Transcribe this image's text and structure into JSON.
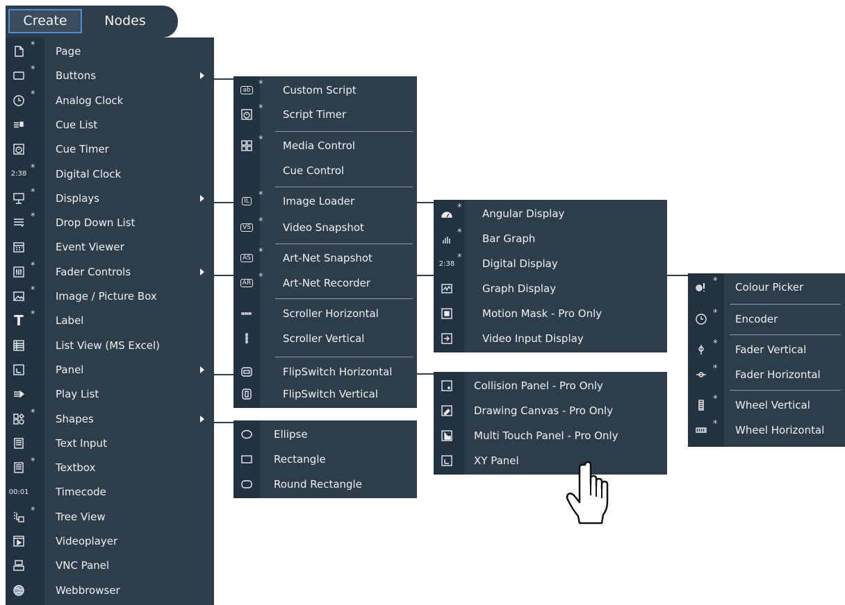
{
  "menubar": {
    "create": "Create",
    "nodes": "Nodes"
  },
  "create_menu": [
    {
      "icon": "page-icon",
      "label": "Page",
      "star": true
    },
    {
      "icon": "button-icon",
      "label": "Buttons",
      "star": true,
      "submenu": true
    },
    {
      "icon": "analog-clock-icon",
      "label": "Analog Clock",
      "star": true
    },
    {
      "icon": "cue-list-icon",
      "label": "Cue List",
      "star": false
    },
    {
      "icon": "cue-timer-icon",
      "label": "Cue Timer",
      "star": false
    },
    {
      "icon": "digital-clock-icon",
      "label": "Digital Clock",
      "star": true,
      "glyph": "2:38"
    },
    {
      "icon": "display-icon",
      "label": "Displays",
      "star": true,
      "submenu": true
    },
    {
      "icon": "drop-down-icon",
      "label": "Drop Down List",
      "star": true
    },
    {
      "icon": "calendar-icon",
      "label": "Event Viewer",
      "star": false
    },
    {
      "icon": "fader-icon",
      "label": "Fader Controls",
      "star": true,
      "submenu": true
    },
    {
      "icon": "picture-icon",
      "label": "Image / Picture Box",
      "star": true
    },
    {
      "icon": "label-icon",
      "label": "Label",
      "star": true,
      "glyph": "T"
    },
    {
      "icon": "list-view-icon",
      "label": "List View (MS Excel)",
      "star": false
    },
    {
      "icon": "panel-icon",
      "label": "Panel",
      "star": false,
      "submenu": true
    },
    {
      "icon": "play-list-icon",
      "label": "Play List",
      "star": false
    },
    {
      "icon": "shapes-icon",
      "label": "Shapes",
      "star": true,
      "submenu": true
    },
    {
      "icon": "text-input-icon",
      "label": "Text Input",
      "star": false
    },
    {
      "icon": "textbox-icon",
      "label": "Textbox",
      "star": true
    },
    {
      "icon": "timecode-icon",
      "label": "Timecode",
      "star": false,
      "glyph": "00:01"
    },
    {
      "icon": "tree-view-icon",
      "label": "Tree View",
      "star": true
    },
    {
      "icon": "videoplayer-icon",
      "label": "Videoplayer",
      "star": false
    },
    {
      "icon": "vnc-icon",
      "label": "VNC Panel",
      "star": false
    },
    {
      "icon": "globe-icon",
      "label": "Webbrowser",
      "star": false
    }
  ],
  "buttons_menu": [
    {
      "icon": "custom-script-icon",
      "label": "Custom Script",
      "star": true,
      "glyph": "ab"
    },
    {
      "icon": "script-timer-icon",
      "label": "Script Timer",
      "star": true
    },
    {
      "icon": "media-control-icon",
      "label": "Media Control",
      "star": true
    },
    {
      "icon": "",
      "label": "Cue Control",
      "star": false
    },
    {
      "icon": "image-loader-icon",
      "label": "Image Loader",
      "star": true,
      "glyph": "IL"
    },
    {
      "icon": "video-snapshot-icon",
      "label": "Video Snapshot",
      "star": true,
      "glyph": "VS"
    },
    {
      "icon": "artnet-snapshot-icon",
      "label": "Art-Net Snapshot",
      "star": true,
      "glyph": "AS"
    },
    {
      "icon": "artnet-recorder-icon",
      "label": "Art-Net Recorder",
      "star": true,
      "glyph": "AR"
    },
    {
      "icon": "scroller-horizontal-icon",
      "label": "Scroller Horizontal",
      "star": false
    },
    {
      "icon": "scroller-vertical-icon",
      "label": "Scroller Vertical",
      "star": false
    },
    {
      "icon": "flipswitch-horizontal-icon",
      "label": "FlipSwitch Horizontal",
      "star": false
    },
    {
      "icon": "flipswitch-vertical-icon",
      "label": "FlipSwitch Vertical",
      "star": false
    }
  ],
  "displays_menu": [
    {
      "icon": "angular-display-icon",
      "label": "Angular Display",
      "star": true
    },
    {
      "icon": "bar-graph-icon",
      "label": "Bar Graph",
      "star": true
    },
    {
      "icon": "digital-display-icon",
      "label": "Digital Display",
      "star": true,
      "glyph": "2:38"
    },
    {
      "icon": "graph-display-icon",
      "label": "Graph Display",
      "star": false
    },
    {
      "icon": "motion-mask-icon",
      "label": "Motion Mask - Pro Only",
      "star": false
    },
    {
      "icon": "video-input-icon",
      "label": "Video Input Display",
      "star": false
    }
  ],
  "fader_menu": [
    {
      "icon": "colour-picker-icon",
      "label": "Colour Picker",
      "star": true
    },
    {
      "icon": "encoder-icon",
      "label": "Encoder",
      "star": true
    },
    {
      "icon": "fader-vertical-icon",
      "label": "Fader Vertical",
      "star": true
    },
    {
      "icon": "fader-horizontal-icon",
      "label": "Fader Horizontal",
      "star": true
    },
    {
      "icon": "wheel-vertical-icon",
      "label": "Wheel Vertical",
      "star": true
    },
    {
      "icon": "wheel-horizontal-icon",
      "label": "Wheel Horizontal",
      "star": true
    }
  ],
  "panel_menu": [
    {
      "icon": "collision-panel-icon",
      "label": "Collision Panel - Pro Only"
    },
    {
      "icon": "drawing-canvas-icon",
      "label": "Drawing Canvas - Pro Only"
    },
    {
      "icon": "multi-touch-icon",
      "label": "Multi Touch Panel - Pro Only"
    },
    {
      "icon": "xy-panel-icon",
      "label": "XY Panel"
    }
  ],
  "shapes_menu": [
    {
      "icon": "ellipse-icon",
      "label": "Ellipse"
    },
    {
      "icon": "rectangle-icon",
      "label": "Rectangle"
    },
    {
      "icon": "round-rectangle-icon",
      "label": "Round Rectangle"
    }
  ],
  "star_glyph": "*"
}
